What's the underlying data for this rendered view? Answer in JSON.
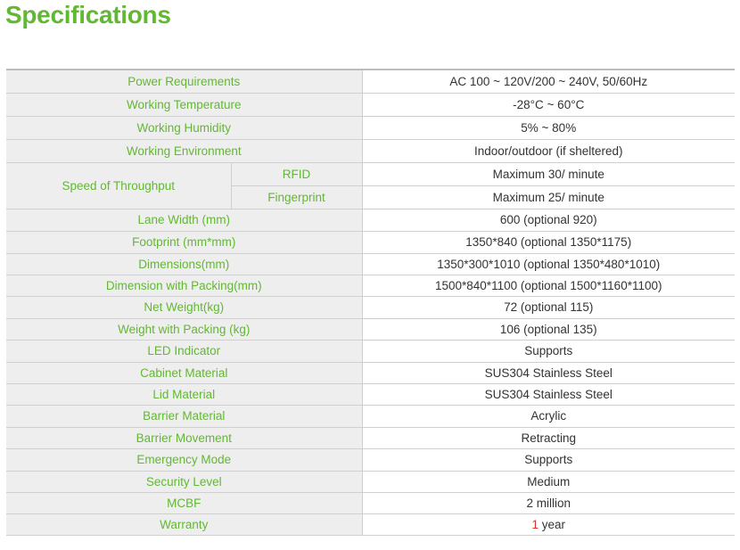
{
  "title": "Specifications",
  "rows": [
    {
      "label": "Power Requirements",
      "value": "AC 100 ~ 120V/200 ~ 240V, 50/60Hz"
    },
    {
      "label": "Working Temperature",
      "value": "-28°C ~ 60°C"
    },
    {
      "label": "Working Humidity",
      "value": "5% ~ 80%"
    },
    {
      "label": "Working Environment",
      "value": "Indoor/outdoor (if sheltered)"
    },
    {
      "label": "Lane Width (mm)",
      "value": "600 (optional 920)"
    },
    {
      "label": "Footprint (mm*mm)",
      "value": "1350*840 (optional 1350*1175)"
    },
    {
      "label": "Dimensions(mm)",
      "value": "1350*300*1010 (optional 1350*480*1010)"
    },
    {
      "label": "Dimension with Packing(mm)",
      "value": "1500*840*1100 (optional 1500*1160*1100)"
    },
    {
      "label": "Net Weight(kg)",
      "value": "72 (optional 115)"
    },
    {
      "label": "Weight with Packing (kg)",
      "value": "106 (optional 135)"
    },
    {
      "label": "LED Indicator",
      "value": "Supports"
    },
    {
      "label": "Cabinet Material",
      "value": "SUS304 Stainless Steel"
    },
    {
      "label": "Lid Material",
      "value": "SUS304 Stainless Steel"
    },
    {
      "label": "Barrier Material",
      "value": "Acrylic"
    },
    {
      "label": "Barrier Movement",
      "value": "Retracting"
    },
    {
      "label": "Emergency Mode",
      "value": "Supports"
    },
    {
      "label": "Security Level",
      "value": "Medium"
    },
    {
      "label": "MCBF",
      "value": "2 million"
    }
  ],
  "throughput": {
    "label": "Speed of Throughput",
    "rfid": {
      "label": "RFID",
      "value": "Maximum 30/ minute"
    },
    "fingerprint": {
      "label": "Fingerprint",
      "value": "Maximum 25/ minute"
    }
  },
  "warranty": {
    "label": "Warranty",
    "value_number": "1",
    "value_unit": " year"
  },
  "colors": {
    "accent_green": "#62b832",
    "label_bg": "#eeeeee",
    "highlight_red": "#d9322b"
  }
}
